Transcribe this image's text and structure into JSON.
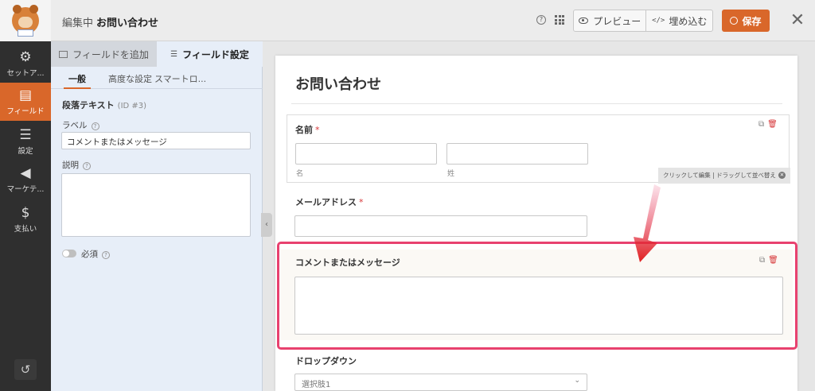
{
  "header": {
    "editing_prefix": "編集中",
    "form_title": "お問い合わせ",
    "help_icon": "question-icon",
    "preview_label": "プレビュー",
    "embed_label": "埋め込む",
    "save_label": "保存",
    "accent": "#d9672a"
  },
  "sidebar": {
    "items": [
      {
        "label": "セットア...",
        "icon": "gear-icon"
      },
      {
        "label": "フィールド",
        "icon": "fields-icon"
      },
      {
        "label": "設定",
        "icon": "sliders-icon"
      },
      {
        "label": "マーケテ...",
        "icon": "megaphone-icon"
      },
      {
        "label": "支払い",
        "icon": "dollar-icon"
      }
    ],
    "active_index": 1
  },
  "panel": {
    "tabs": [
      {
        "label": "フィールドを追加"
      },
      {
        "label": "フィールド設定"
      }
    ],
    "subtabs": [
      {
        "label": "一般"
      },
      {
        "label": "高度な設定"
      },
      {
        "label": "スマートロ..."
      }
    ],
    "field_type": "段落テキスト",
    "field_id": "(ID #3)",
    "label_caption": "ラベル",
    "label_value": "コメントまたはメッセージ",
    "description_caption": "説明",
    "required_label": "必須"
  },
  "form": {
    "title": "お問い合わせ",
    "name_label": "名前",
    "first_sub": "名",
    "last_sub": "姓",
    "email_label": "メールアドレス",
    "comment_label": "コメントまたはメッセージ",
    "dropdown_label": "ドロップダウン",
    "dropdown_value": "選択肢1",
    "hint_text": "クリックして編集 | ドラッグして並べ替え",
    "highlight_color": "#e8416f"
  }
}
